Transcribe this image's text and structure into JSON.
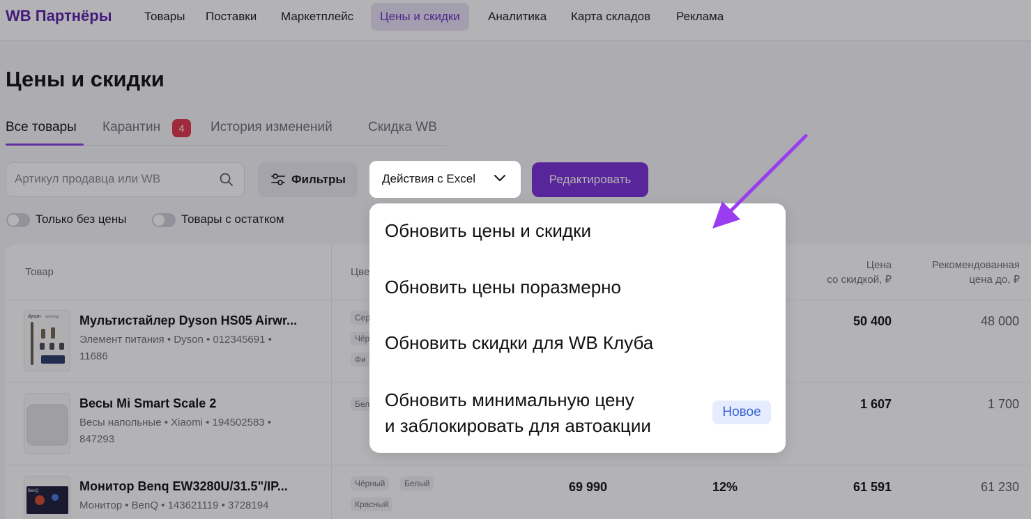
{
  "nav": {
    "logo": "WB Партнёры",
    "items": [
      "Товары",
      "Поставки",
      "Маркетплейс",
      "Цены и скидки",
      "Аналитика",
      "Карта складов",
      "Реклама"
    ],
    "active_index": 3
  },
  "page": {
    "title": "Цены и скидки"
  },
  "tabs": {
    "items": [
      "Все товары",
      "Карантин",
      "История изменений",
      "Скидка WB"
    ],
    "quarantine_count": "4",
    "active_index": 0
  },
  "toolbar": {
    "search_placeholder": "Артикул продавца или WB",
    "filters_label": "Фильтры",
    "excel_label": "Действия с Excel",
    "edit_label": "Редактировать"
  },
  "toggles": {
    "no_price": "Только без цены",
    "with_stock": "Товары с остатком"
  },
  "table": {
    "headers": {
      "product": "Товар",
      "color": "Цве",
      "discount_price_line1": "Цена",
      "discount_price_line2": "со скидкой, ₽",
      "recommended_line1": "Рекомендованная",
      "recommended_line2": "цена до, ₽"
    },
    "rows": [
      {
        "name": "Мультистайлер Dyson HS05 Airwr...",
        "sub": "Элемент питания • Dyson • 012345691 • 11686",
        "chips": [
          "Сер",
          "Чёр",
          "Фи"
        ],
        "price": "",
        "discount": "",
        "discount_price": "50 400",
        "recommended": "48 000"
      },
      {
        "name": "Весы Mi Smart Scale 2",
        "sub": "Весы напольные • Xiaomi • 194502583 • 847293",
        "chips": [
          "Бел"
        ],
        "price": "",
        "discount": "",
        "discount_price": "1 607",
        "recommended": "1 700"
      },
      {
        "name": "Монитор Benq EW3280U/31.5\"/IP...",
        "sub": "Монитор • BenQ • 143621119 • 3728194",
        "chips": [
          "Чёрный",
          "Белый",
          "Красный"
        ],
        "price": "69 990",
        "discount": "12%",
        "discount_price": "61 591",
        "recommended": "61 230"
      }
    ]
  },
  "dropdown": {
    "items": [
      "Обновить цены и скидки",
      "Обновить цены поразмерно",
      "Обновить скидки для WB Клуба",
      "Обновить минимальную цену",
      "и заблокировать для автоакции"
    ],
    "new_badge": "Новое"
  },
  "colors": {
    "accent": "#7b2fd6",
    "arrow": "#9a3cf0",
    "badge_red": "#e0354a",
    "badge_blue_bg": "#e4ecfd"
  }
}
